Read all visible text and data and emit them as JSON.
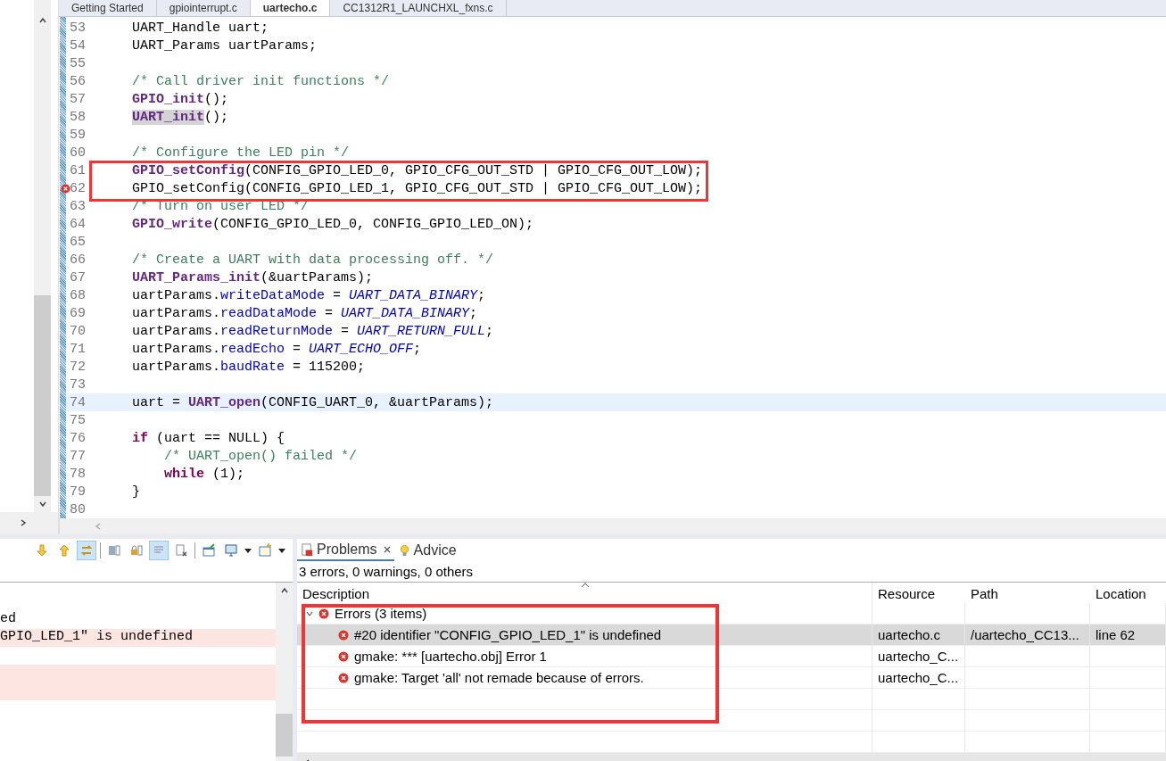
{
  "editor": {
    "tabs": [
      {
        "label": "Getting Started",
        "selected": false
      },
      {
        "label": "gpiointerrupt.c",
        "selected": false
      },
      {
        "label": "uartecho.c",
        "selected": true
      },
      {
        "label": "CC1312R1_LAUNCHXL_fxns.c",
        "selected": false
      }
    ],
    "lines": [
      {
        "number": "53",
        "current": false,
        "error": false,
        "tokens": [
          {
            "kind": "plain",
            "text": "    UART_Handle uart;"
          }
        ]
      },
      {
        "number": "54",
        "current": false,
        "error": false,
        "tokens": [
          {
            "kind": "plain",
            "text": "    UART_Params uartParams;"
          }
        ]
      },
      {
        "number": "55",
        "current": false,
        "error": false
      },
      {
        "number": "56",
        "current": false,
        "error": false,
        "tokens": [
          {
            "kind": "comment",
            "text": "    /* Call driver init functions */"
          }
        ]
      },
      {
        "number": "57",
        "current": false,
        "error": false,
        "tokens": [
          {
            "kind": "function",
            "text": "    GPIO_init"
          },
          {
            "kind": "plain",
            "text": "();"
          }
        ]
      },
      {
        "number": "58",
        "current": false,
        "error": false,
        "tokens": [
          {
            "kind": "occurrence",
            "text": "    UART_init"
          },
          {
            "kind": "plain",
            "text": "();"
          }
        ]
      },
      {
        "number": "59",
        "current": false,
        "error": false
      },
      {
        "number": "60",
        "current": false,
        "error": false,
        "tokens": [
          {
            "kind": "comment",
            "text": "    /* Configure the LED pin */"
          }
        ]
      },
      {
        "number": "61",
        "current": false,
        "error": false,
        "tokens": [
          {
            "kind": "function",
            "text": "    GPIO_setConfig"
          },
          {
            "kind": "plain",
            "text": "(CONFIG_GPIO_LED_0, GPIO_CFG_OUT_STD | GPIO_CFG_OUT_LOW);"
          }
        ]
      },
      {
        "number": "62",
        "current": false,
        "error": true,
        "tokens": [
          {
            "kind": "plain",
            "text": "    GPIO_setConfig(CONFIG_GPIO_LED_1, GPIO_CFG_OUT_STD | GPIO_CFG_OUT_LOW);"
          }
        ]
      },
      {
        "number": "63",
        "current": false,
        "error": false,
        "tokens": [
          {
            "kind": "comment",
            "text": "    /* Turn on user LED */"
          }
        ]
      },
      {
        "number": "64",
        "current": false,
        "error": false,
        "tokens": [
          {
            "kind": "function",
            "text": "    GPIO_write"
          },
          {
            "kind": "plain",
            "text": "(CONFIG_GPIO_LED_0, CONFIG_GPIO_LED_ON);"
          }
        ]
      },
      {
        "number": "65",
        "current": false,
        "error": false
      },
      {
        "number": "66",
        "current": false,
        "error": false,
        "tokens": [
          {
            "kind": "comment",
            "text": "    /* Create a UART with data processing off. */"
          }
        ]
      },
      {
        "number": "67",
        "current": false,
        "error": false,
        "tokens": [
          {
            "kind": "function",
            "text": "    UART_Params_init"
          },
          {
            "kind": "plain",
            "text": "(&uartParams);"
          }
        ]
      },
      {
        "number": "68",
        "current": false,
        "error": false,
        "tokens": [
          {
            "kind": "plain",
            "text": "    uartParams."
          },
          {
            "kind": "field",
            "text": "writeDataMode"
          },
          {
            "kind": "plain",
            "text": " = "
          },
          {
            "kind": "constant",
            "text": "UART_DATA_BINARY"
          },
          {
            "kind": "plain",
            "text": ";"
          }
        ]
      },
      {
        "number": "69",
        "current": false,
        "error": false,
        "tokens": [
          {
            "kind": "plain",
            "text": "    uartParams."
          },
          {
            "kind": "field",
            "text": "readDataMode"
          },
          {
            "kind": "plain",
            "text": " = "
          },
          {
            "kind": "constant",
            "text": "UART_DATA_BINARY"
          },
          {
            "kind": "plain",
            "text": ";"
          }
        ]
      },
      {
        "number": "70",
        "current": false,
        "error": false,
        "tokens": [
          {
            "kind": "plain",
            "text": "    uartParams."
          },
          {
            "kind": "field",
            "text": "readReturnMode"
          },
          {
            "kind": "plain",
            "text": " = "
          },
          {
            "kind": "constant",
            "text": "UART_RETURN_FULL"
          },
          {
            "kind": "plain",
            "text": ";"
          }
        ]
      },
      {
        "number": "71",
        "current": false,
        "error": false,
        "tokens": [
          {
            "kind": "plain",
            "text": "    uartParams."
          },
          {
            "kind": "field",
            "text": "readEcho"
          },
          {
            "kind": "plain",
            "text": " = "
          },
          {
            "kind": "constant",
            "text": "UART_ECHO_OFF"
          },
          {
            "kind": "plain",
            "text": ";"
          }
        ]
      },
      {
        "number": "72",
        "current": false,
        "error": false,
        "tokens": [
          {
            "kind": "plain",
            "text": "    uartParams."
          },
          {
            "kind": "field",
            "text": "baudRate"
          },
          {
            "kind": "plain",
            "text": " = 115200;"
          }
        ]
      },
      {
        "number": "73",
        "current": false,
        "error": false
      },
      {
        "number": "74",
        "current": true,
        "error": false,
        "tokens": [
          {
            "kind": "plain",
            "text": "    uart = "
          },
          {
            "kind": "function",
            "text": "UART_open"
          },
          {
            "kind": "plain",
            "text": "(CONFIG_UART_0, &uartParams);"
          }
        ]
      },
      {
        "number": "75",
        "current": false,
        "error": false
      },
      {
        "number": "76",
        "current": false,
        "error": false,
        "tokens": [
          {
            "kind": "keyword",
            "text": "    if"
          },
          {
            "kind": "plain",
            "text": " (uart == NULL) {"
          }
        ]
      },
      {
        "number": "77",
        "current": false,
        "error": false,
        "tokens": [
          {
            "kind": "comment",
            "text": "        /* UART_open() failed */"
          }
        ]
      },
      {
        "number": "78",
        "current": false,
        "error": false,
        "tokens": [
          {
            "kind": "keyword",
            "text": "        while"
          },
          {
            "kind": "plain",
            "text": " (1);"
          }
        ]
      },
      {
        "number": "79",
        "current": false,
        "error": false,
        "tokens": [
          {
            "kind": "plain",
            "text": "    }"
          }
        ]
      },
      {
        "number": "80",
        "current": false,
        "error": false
      }
    ]
  },
  "console": {
    "lines": [
      {
        "kind": "plain"
      },
      {
        "kind": "plain",
        "text": "ed"
      },
      {
        "kind": "error",
        "text": "GPIO_LED_1\" is undefined"
      },
      {
        "kind": "plain"
      },
      {
        "kind": "error"
      },
      {
        "kind": "error"
      }
    ]
  },
  "problems": {
    "tabs": [
      {
        "label": "Problems",
        "selected": true,
        "closable": true
      },
      {
        "label": "Advice",
        "selected": false,
        "closable": false
      }
    ],
    "summary": "3 errors, 0 warnings, 0 others",
    "columns": [
      "Description",
      "Resource",
      "Path",
      "Location"
    ],
    "groups": [
      {
        "label": "Errors (3 items)",
        "expanded": true,
        "items": [
          {
            "description": "#20 identifier \"CONFIG_GPIO_LED_1\" is undefined",
            "resource": "uartecho.c",
            "path": "/uartecho_CC13...",
            "location": "line 62",
            "selected": true
          },
          {
            "description": "gmake: *** [uartecho.obj] Error 1",
            "resource": "uartecho_C...",
            "selected": false
          },
          {
            "description": "gmake: Target 'all' not remade because of errors.",
            "resource": "uartecho_C...",
            "selected": false
          }
        ]
      }
    ]
  }
}
